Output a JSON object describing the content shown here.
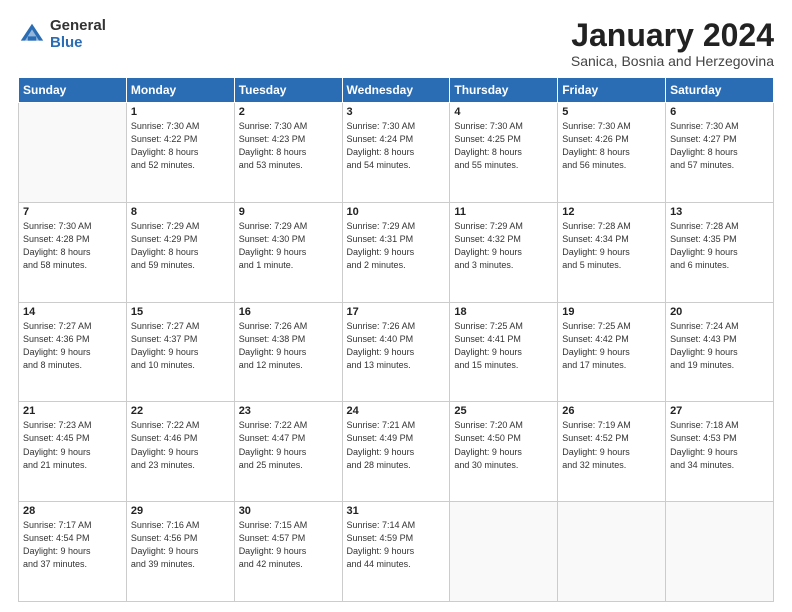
{
  "header": {
    "logo_general": "General",
    "logo_blue": "Blue",
    "month_title": "January 2024",
    "location": "Sanica, Bosnia and Herzegovina"
  },
  "weekdays": [
    "Sunday",
    "Monday",
    "Tuesday",
    "Wednesday",
    "Thursday",
    "Friday",
    "Saturday"
  ],
  "weeks": [
    [
      {
        "day": "",
        "detail": ""
      },
      {
        "day": "1",
        "detail": "Sunrise: 7:30 AM\nSunset: 4:22 PM\nDaylight: 8 hours\nand 52 minutes."
      },
      {
        "day": "2",
        "detail": "Sunrise: 7:30 AM\nSunset: 4:23 PM\nDaylight: 8 hours\nand 53 minutes."
      },
      {
        "day": "3",
        "detail": "Sunrise: 7:30 AM\nSunset: 4:24 PM\nDaylight: 8 hours\nand 54 minutes."
      },
      {
        "day": "4",
        "detail": "Sunrise: 7:30 AM\nSunset: 4:25 PM\nDaylight: 8 hours\nand 55 minutes."
      },
      {
        "day": "5",
        "detail": "Sunrise: 7:30 AM\nSunset: 4:26 PM\nDaylight: 8 hours\nand 56 minutes."
      },
      {
        "day": "6",
        "detail": "Sunrise: 7:30 AM\nSunset: 4:27 PM\nDaylight: 8 hours\nand 57 minutes."
      }
    ],
    [
      {
        "day": "7",
        "detail": "Sunrise: 7:30 AM\nSunset: 4:28 PM\nDaylight: 8 hours\nand 58 minutes."
      },
      {
        "day": "8",
        "detail": "Sunrise: 7:29 AM\nSunset: 4:29 PM\nDaylight: 8 hours\nand 59 minutes."
      },
      {
        "day": "9",
        "detail": "Sunrise: 7:29 AM\nSunset: 4:30 PM\nDaylight: 9 hours\nand 1 minute."
      },
      {
        "day": "10",
        "detail": "Sunrise: 7:29 AM\nSunset: 4:31 PM\nDaylight: 9 hours\nand 2 minutes."
      },
      {
        "day": "11",
        "detail": "Sunrise: 7:29 AM\nSunset: 4:32 PM\nDaylight: 9 hours\nand 3 minutes."
      },
      {
        "day": "12",
        "detail": "Sunrise: 7:28 AM\nSunset: 4:34 PM\nDaylight: 9 hours\nand 5 minutes."
      },
      {
        "day": "13",
        "detail": "Sunrise: 7:28 AM\nSunset: 4:35 PM\nDaylight: 9 hours\nand 6 minutes."
      }
    ],
    [
      {
        "day": "14",
        "detail": "Sunrise: 7:27 AM\nSunset: 4:36 PM\nDaylight: 9 hours\nand 8 minutes."
      },
      {
        "day": "15",
        "detail": "Sunrise: 7:27 AM\nSunset: 4:37 PM\nDaylight: 9 hours\nand 10 minutes."
      },
      {
        "day": "16",
        "detail": "Sunrise: 7:26 AM\nSunset: 4:38 PM\nDaylight: 9 hours\nand 12 minutes."
      },
      {
        "day": "17",
        "detail": "Sunrise: 7:26 AM\nSunset: 4:40 PM\nDaylight: 9 hours\nand 13 minutes."
      },
      {
        "day": "18",
        "detail": "Sunrise: 7:25 AM\nSunset: 4:41 PM\nDaylight: 9 hours\nand 15 minutes."
      },
      {
        "day": "19",
        "detail": "Sunrise: 7:25 AM\nSunset: 4:42 PM\nDaylight: 9 hours\nand 17 minutes."
      },
      {
        "day": "20",
        "detail": "Sunrise: 7:24 AM\nSunset: 4:43 PM\nDaylight: 9 hours\nand 19 minutes."
      }
    ],
    [
      {
        "day": "21",
        "detail": "Sunrise: 7:23 AM\nSunset: 4:45 PM\nDaylight: 9 hours\nand 21 minutes."
      },
      {
        "day": "22",
        "detail": "Sunrise: 7:22 AM\nSunset: 4:46 PM\nDaylight: 9 hours\nand 23 minutes."
      },
      {
        "day": "23",
        "detail": "Sunrise: 7:22 AM\nSunset: 4:47 PM\nDaylight: 9 hours\nand 25 minutes."
      },
      {
        "day": "24",
        "detail": "Sunrise: 7:21 AM\nSunset: 4:49 PM\nDaylight: 9 hours\nand 28 minutes."
      },
      {
        "day": "25",
        "detail": "Sunrise: 7:20 AM\nSunset: 4:50 PM\nDaylight: 9 hours\nand 30 minutes."
      },
      {
        "day": "26",
        "detail": "Sunrise: 7:19 AM\nSunset: 4:52 PM\nDaylight: 9 hours\nand 32 minutes."
      },
      {
        "day": "27",
        "detail": "Sunrise: 7:18 AM\nSunset: 4:53 PM\nDaylight: 9 hours\nand 34 minutes."
      }
    ],
    [
      {
        "day": "28",
        "detail": "Sunrise: 7:17 AM\nSunset: 4:54 PM\nDaylight: 9 hours\nand 37 minutes."
      },
      {
        "day": "29",
        "detail": "Sunrise: 7:16 AM\nSunset: 4:56 PM\nDaylight: 9 hours\nand 39 minutes."
      },
      {
        "day": "30",
        "detail": "Sunrise: 7:15 AM\nSunset: 4:57 PM\nDaylight: 9 hours\nand 42 minutes."
      },
      {
        "day": "31",
        "detail": "Sunrise: 7:14 AM\nSunset: 4:59 PM\nDaylight: 9 hours\nand 44 minutes."
      },
      {
        "day": "",
        "detail": ""
      },
      {
        "day": "",
        "detail": ""
      },
      {
        "day": "",
        "detail": ""
      }
    ]
  ]
}
